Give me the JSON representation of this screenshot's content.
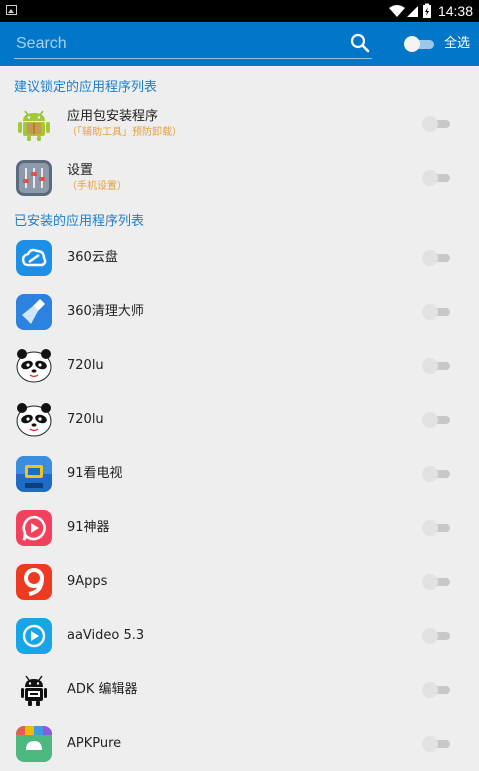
{
  "status_bar": {
    "time": "14:38"
  },
  "search": {
    "placeholder": "Search"
  },
  "header": {
    "select_all": "全选"
  },
  "sections": {
    "suggested": "建议锁定的应用程序列表",
    "installed": "已安装的应用程序列表"
  },
  "suggested_apps": [
    {
      "name": "应用包安装程序",
      "sub": "（「辅助工具」预防卸载）",
      "icon": "android-installer-icon"
    },
    {
      "name": "设置",
      "sub": "（手机设置）",
      "icon": "settings-sliders-icon"
    }
  ],
  "installed_apps": [
    {
      "name": "360云盘",
      "icon": "cloud-icon"
    },
    {
      "name": "360清理大师",
      "icon": "broom-icon"
    },
    {
      "name": "720lu",
      "icon": "panda-icon"
    },
    {
      "name": "720lu",
      "icon": "panda-icon"
    },
    {
      "name": "91看电视",
      "icon": "tv-icon"
    },
    {
      "name": "91神器",
      "icon": "play-bubble-icon"
    },
    {
      "name": "9Apps",
      "icon": "nine-icon"
    },
    {
      "name": "aaVideo 5.3",
      "icon": "play-circle-icon"
    },
    {
      "name": "ADK 编辑器",
      "icon": "android-robot-icon"
    },
    {
      "name": "APKPure",
      "icon": "android-store-icon"
    }
  ],
  "colors": {
    "app_bar": "#0277c9",
    "section_header": "#1a7fce",
    "subtitle": "#e89f3b",
    "background": "#eeeeee"
  }
}
